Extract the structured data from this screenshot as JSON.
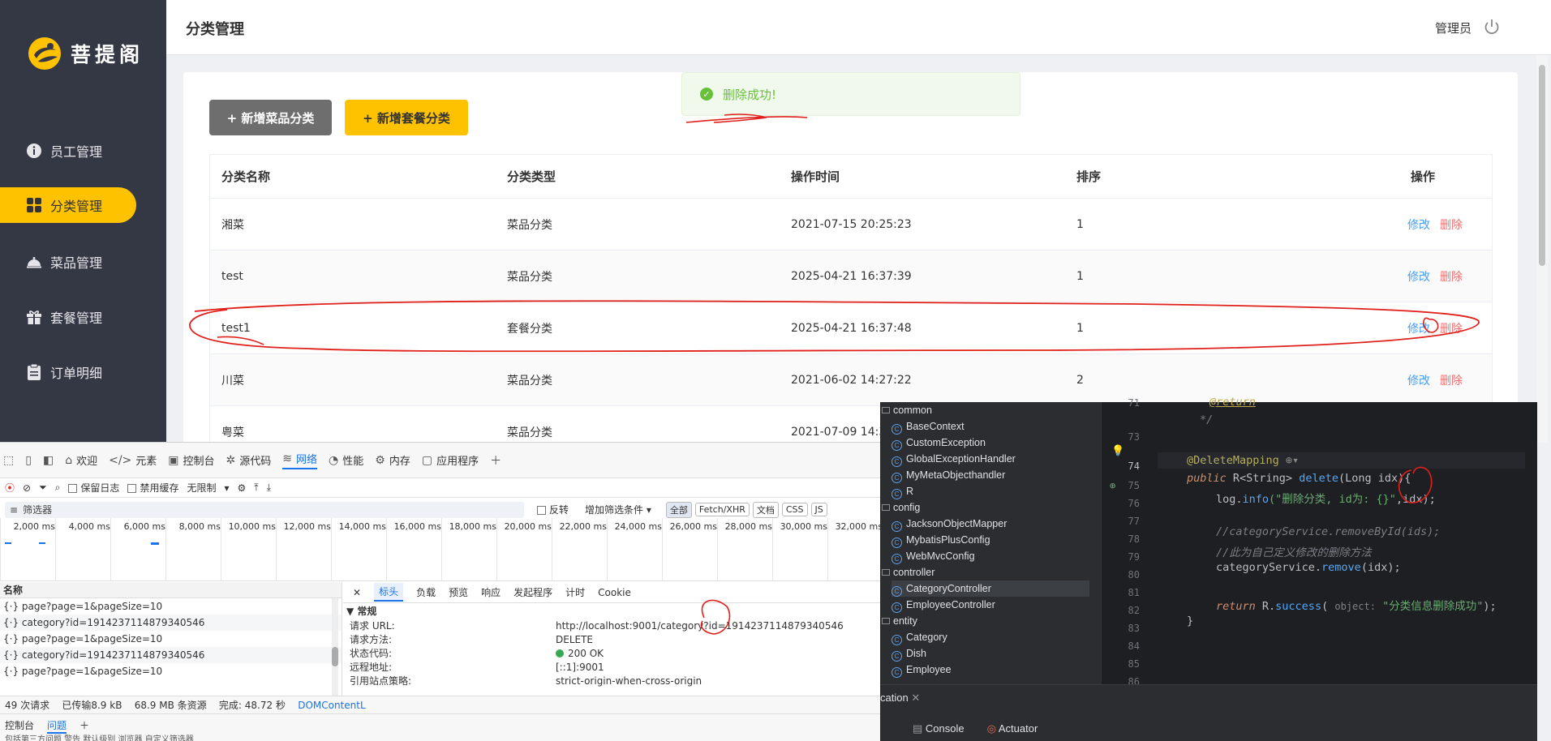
{
  "app": {
    "logo_text": "菩提阁",
    "page_title": "分类管理",
    "user_name": "管理员"
  },
  "sidebar": {
    "items": [
      {
        "label": "员工管理",
        "icon": "info-icon"
      },
      {
        "label": "分类管理",
        "icon": "grid-icon",
        "active": true
      },
      {
        "label": "菜品管理",
        "icon": "dish-cover-icon"
      },
      {
        "label": "套餐管理",
        "icon": "package-icon"
      },
      {
        "label": "订单明细",
        "icon": "clipboard-icon"
      }
    ]
  },
  "toolbar": {
    "add_dish_category": "+ 新增菜品分类",
    "add_set_category": "+ 新增套餐分类"
  },
  "toast": {
    "message": "删除成功!"
  },
  "table": {
    "headers": [
      "分类名称",
      "分类类型",
      "操作时间",
      "排序",
      "操作"
    ],
    "edit_label": "修改",
    "delete_label": "删除",
    "rows": [
      {
        "name": "湘菜",
        "type": "菜品分类",
        "time": "2021-07-15 20:25:23",
        "sort": "1"
      },
      {
        "name": "test",
        "type": "菜品分类",
        "time": "2025-04-21 16:37:39",
        "sort": "1"
      },
      {
        "name": "test1",
        "type": "套餐分类",
        "time": "2025-04-21 16:37:48",
        "sort": "1"
      },
      {
        "name": "川菜",
        "type": "菜品分类",
        "time": "2021-06-02 14:27:22",
        "sort": "2"
      },
      {
        "name": "粤菜",
        "type": "菜品分类",
        "time": "2021-07-09 14:37"
      }
    ]
  },
  "devtools": {
    "tabs": [
      "欢迎",
      "元素",
      "控制台",
      "源代码",
      "网络",
      "性能",
      "内存",
      "应用程序"
    ],
    "active_tab": "网络",
    "toolbar": {
      "preserve_log": "保留日志",
      "disable_cache": "禁用缓存",
      "throttle": "无限制"
    },
    "filter": {
      "placeholder": "筛选器",
      "invert": "反转",
      "more_filters": "增加筛选条件",
      "types": [
        "全部",
        "Fetch/XHR",
        "文档",
        "CSS",
        "JS"
      ]
    },
    "timeline_ticks": [
      "2,000 ms",
      "4,000 ms",
      "6,000 ms",
      "8,000 ms",
      "10,000 ms",
      "12,000 ms",
      "14,000 ms",
      "16,000 ms",
      "18,000 ms",
      "20,000 ms",
      "22,000 ms",
      "24,000 ms",
      "26,000 ms",
      "28,000 ms",
      "30,000 ms",
      "32,000 ms"
    ],
    "request_list": {
      "header": "名称",
      "items": [
        "page?page=1&pageSize=10",
        "category?id=1914237114879340546",
        "page?page=1&pageSize=10",
        "category?id=1914237114879340546",
        "page?page=1&pageSize=10"
      ]
    },
    "detail_tabs": [
      "标头",
      "负载",
      "预览",
      "响应",
      "发起程序",
      "计时",
      "Cookie"
    ],
    "detail_active": "标头",
    "general_section": "▼ 常规",
    "general": [
      {
        "key": "请求 URL:",
        "value": "http://localhost:9001/category?id=1914237114879340546"
      },
      {
        "key": "请求方法:",
        "value": "DELETE"
      },
      {
        "key": "状态代码:",
        "value": "200 OK"
      },
      {
        "key": "远程地址:",
        "value": "[::1]:9001"
      },
      {
        "key": "引用站点策略:",
        "value": "strict-origin-when-cross-origin"
      }
    ],
    "status_bar": {
      "requests": "49 次请求",
      "transferred": "已传输8.9 kB",
      "resources": "68.9 MB 条资源",
      "finish": "完成: 48.72 秒",
      "dom": "DOMContentL"
    },
    "drawer_tabs": [
      "控制台",
      "问题"
    ],
    "drawer_more": "包括第三方问题   警告   默认级别   浏览器   自定义筛选器"
  },
  "ide": {
    "tree": [
      {
        "label": "common",
        "kind": "folder"
      },
      {
        "label": "BaseContext",
        "kind": "class"
      },
      {
        "label": "CustomException",
        "kind": "class"
      },
      {
        "label": "GlobalExceptionHandler",
        "kind": "class"
      },
      {
        "label": "MyMetaObjecthandler",
        "kind": "class"
      },
      {
        "label": "R",
        "kind": "class"
      },
      {
        "label": "config",
        "kind": "folder"
      },
      {
        "label": "JacksonObjectMapper",
        "kind": "class"
      },
      {
        "label": "MybatisPlusConfig",
        "kind": "class"
      },
      {
        "label": "WebMvcConfig",
        "kind": "class"
      },
      {
        "label": "controller",
        "kind": "folder"
      },
      {
        "label": "CategoryController",
        "kind": "class",
        "selected": true
      },
      {
        "label": "EmployeeController",
        "kind": "class"
      },
      {
        "label": "entity",
        "kind": "folder"
      },
      {
        "label": "Category",
        "kind": "class"
      },
      {
        "label": "Dish",
        "kind": "class"
      },
      {
        "label": "Employee",
        "kind": "class"
      }
    ],
    "line_numbers": [
      "71",
      "72",
      "73",
      "74",
      "75",
      "76",
      "77",
      "78",
      "79",
      "80",
      "81",
      "82",
      "83",
      "84",
      "85",
      "86"
    ],
    "code": {
      "l71": "@return",
      "l72": "*/",
      "l74_ann": "@DeleteMapping",
      "l75_public": "public",
      "l75_rest": " R<String> ",
      "l75_fn": "delete",
      "l75_params": "(Long idx){",
      "l76_a": "log.",
      "l76_fn": "info",
      "l76_str": "(\"删除分类, id为: {}\"",
      "l76_b": ",idx);",
      "l78": "//categoryService.removeById(ids);",
      "l79": "//此为自己定义修改的删除方法",
      "l80_a": "categoryService.",
      "l80_fn": "remove",
      "l80_b": "(idx);",
      "l82_return": "return",
      "l82_a": " R.",
      "l82_fn": "success",
      "l82_hint": "object:",
      "l82_str": "\"分类信息删除成功\"",
      "l82_b": ");",
      "l83": "}"
    },
    "bottom_tab": "cation",
    "tools": [
      "Console",
      "Actuator"
    ]
  },
  "colors": {
    "sidebar_bg": "#343744",
    "accent": "#ffc200",
    "success": "#67c23a",
    "edit_link": "#419eff",
    "delete_link": "#f56c6c",
    "annotation": "#e0201b"
  }
}
